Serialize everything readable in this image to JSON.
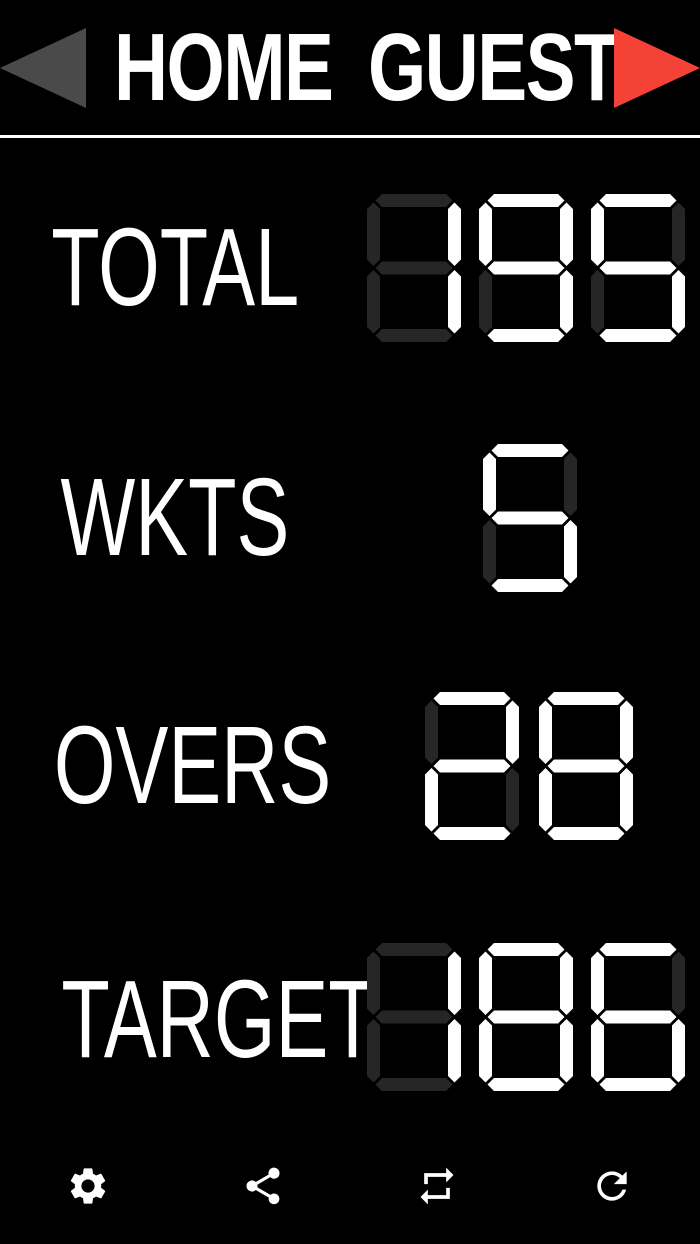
{
  "header": {
    "home_label": "HOME",
    "guest_label": "GUEST",
    "active_team": "guest",
    "inactive_arrow_color": "#4a4a4a",
    "active_arrow_color": "#f44336"
  },
  "rows": [
    {
      "key": "total",
      "label": "TOTAL",
      "value": "195"
    },
    {
      "key": "wkts",
      "label": "WKTS",
      "value": "5"
    },
    {
      "key": "overs",
      "label": "OVERS",
      "value": "28"
    },
    {
      "key": "target",
      "label": "TARGET",
      "value": "186"
    }
  ],
  "display": {
    "lit_color": "#ffffff",
    "unlit_color": "#262626"
  },
  "toolbar": {
    "icons": [
      "settings-icon",
      "share-icon",
      "swap-icon",
      "refresh-icon"
    ]
  }
}
